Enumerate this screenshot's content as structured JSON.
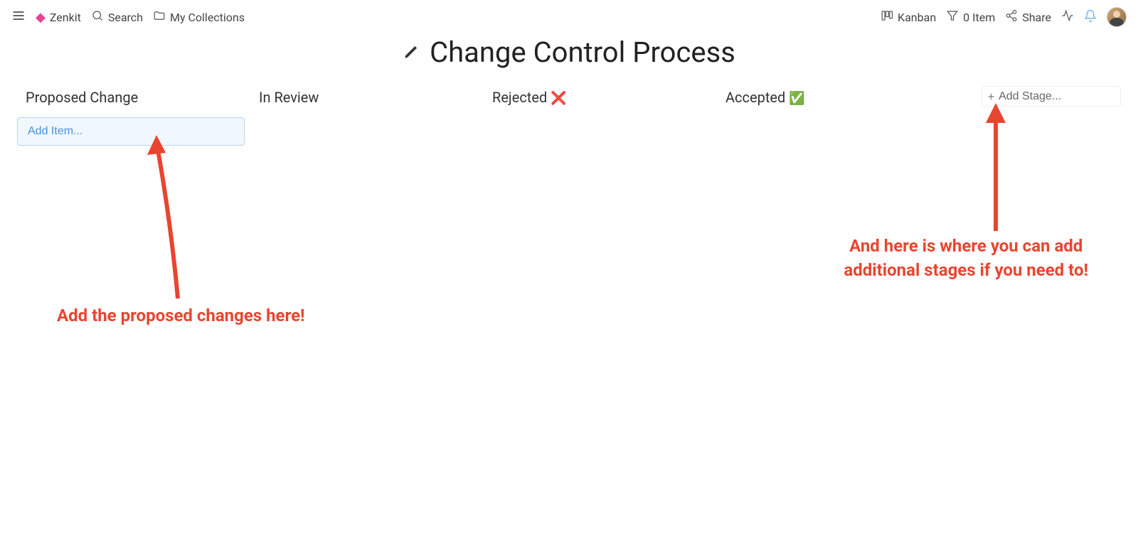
{
  "header": {
    "brand": "Zenkit",
    "search": "Search",
    "collections": "My Collections",
    "viewMode": "Kanban",
    "filterCount": "0 Item",
    "share": "Share"
  },
  "title": "Change Control Process",
  "columns": [
    {
      "label": "Proposed Change",
      "emoji": ""
    },
    {
      "label": "In Review",
      "emoji": ""
    },
    {
      "label": "Rejected",
      "emoji": "❌"
    },
    {
      "label": "Accepted",
      "emoji": "✅"
    }
  ],
  "addItemPlaceholder": "Add Item...",
  "addStagePlaceholder": "Add Stage...",
  "annotations": {
    "left": "Add the proposed changes here!",
    "rightLine1": "And here is where you can add",
    "rightLine2": "additional stages if you need to!"
  }
}
